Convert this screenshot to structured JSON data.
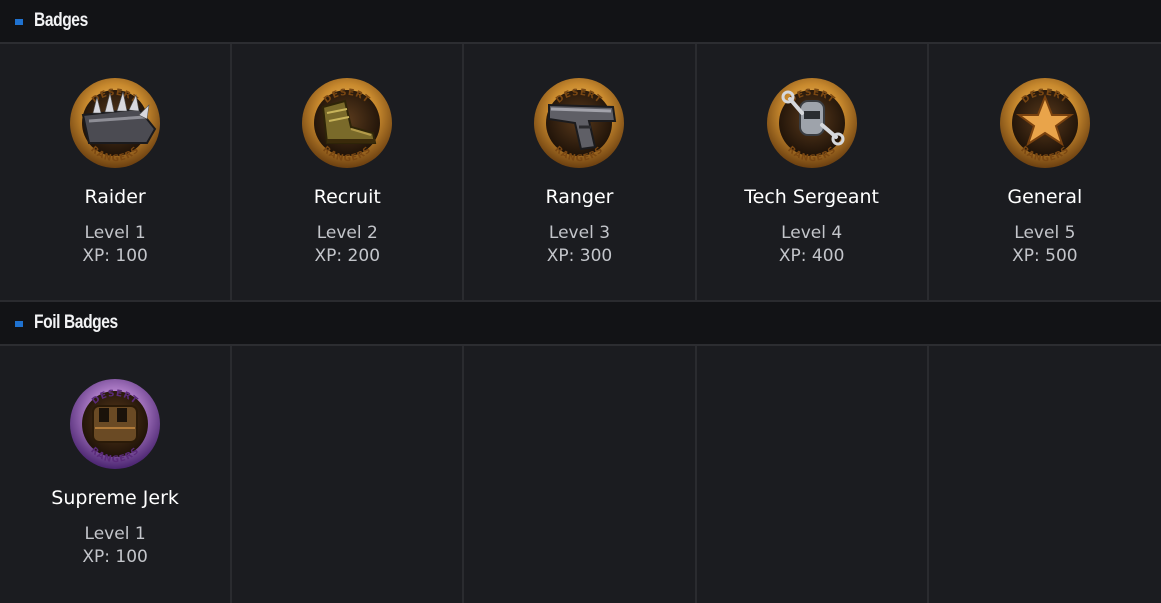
{
  "sections": {
    "badges": {
      "title": "Badges",
      "items": [
        {
          "name": "Raider",
          "level": "Level 1",
          "xp": "XP: 100",
          "icon": "spiked-glove-badge-icon",
          "ring_top": "DESERT",
          "ring_bottom": "RANGERS"
        },
        {
          "name": "Recruit",
          "level": "Level 2",
          "xp": "XP: 200",
          "icon": "boot-badge-icon",
          "ring_top": "DESERT",
          "ring_bottom": "RANGERS"
        },
        {
          "name": "Ranger",
          "level": "Level 3",
          "xp": "XP: 300",
          "icon": "pistol-badge-icon",
          "ring_top": "DESERT",
          "ring_bottom": "RANGERS"
        },
        {
          "name": "Tech Sergeant",
          "level": "Level 4",
          "xp": "XP: 400",
          "icon": "robot-wrench-badge-icon",
          "ring_top": "DESERT",
          "ring_bottom": "RANGERS"
        },
        {
          "name": "General",
          "level": "Level 5",
          "xp": "XP: 500",
          "icon": "star-badge-icon",
          "ring_top": "DESERT",
          "ring_bottom": "RANGERS"
        }
      ]
    },
    "foil_badges": {
      "title": "Foil Badges",
      "items": [
        {
          "name": "Supreme Jerk",
          "level": "Level 1",
          "xp": "XP: 100",
          "icon": "toaster-foil-badge-icon",
          "ring_top": "DESERT",
          "ring_bottom": "RANGERS"
        }
      ]
    }
  },
  "colors": {
    "background": "#1b1c20",
    "header_background": "#121316",
    "accent_marker": "#1f72d0",
    "gold_ring": "#c98a2e",
    "foil_ring": "#9b5fc0"
  }
}
